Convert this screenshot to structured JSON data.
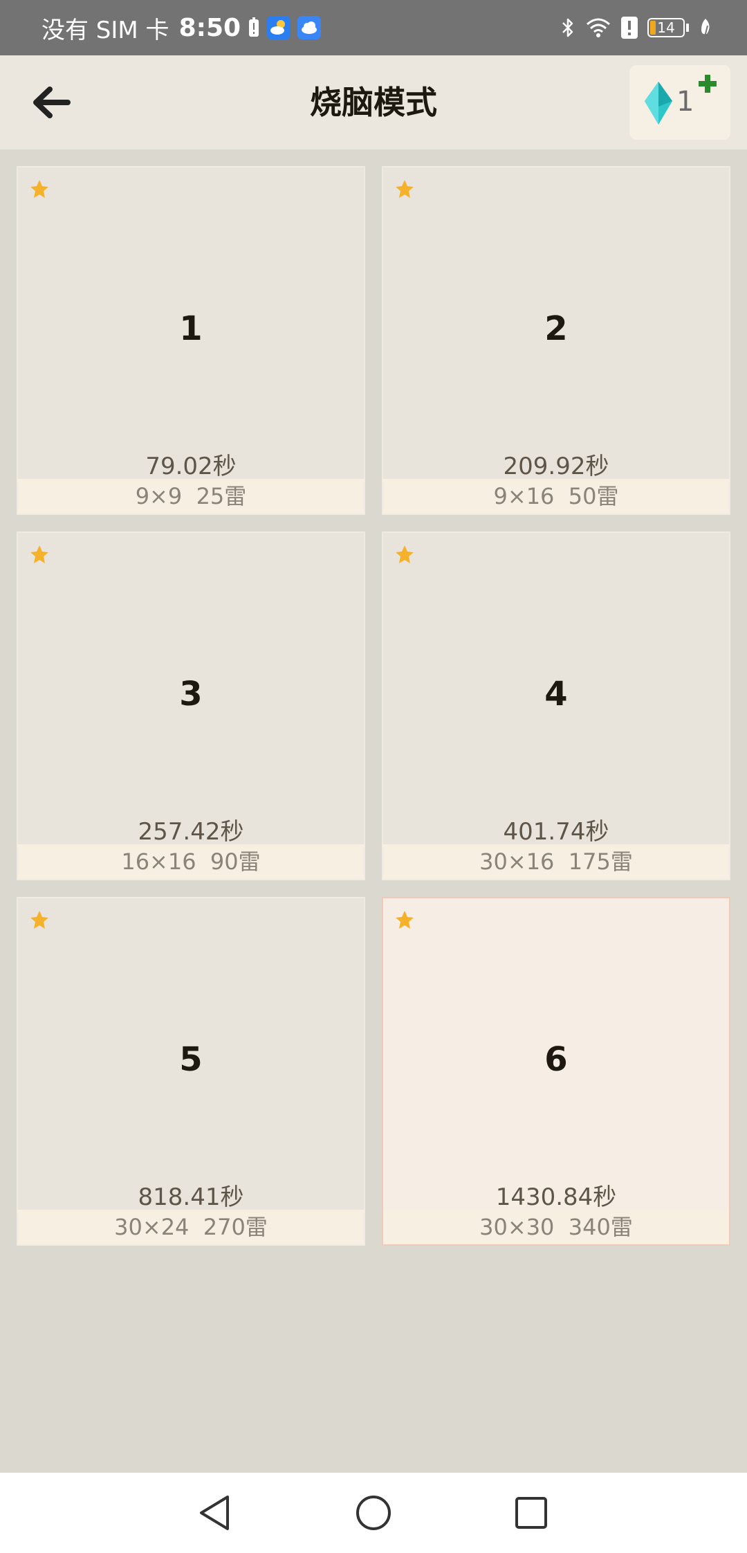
{
  "status_bar": {
    "carrier": "没有 SIM 卡",
    "time": "8:50",
    "battery_level": "14"
  },
  "header": {
    "title": "烧脑模式",
    "gem_count": "1"
  },
  "levels": [
    {
      "number": "1",
      "time": "79.02秒",
      "info": "9×9  25雷",
      "starred": true
    },
    {
      "number": "2",
      "time": "209.92秒",
      "info": "9×16  50雷",
      "starred": true
    },
    {
      "number": "3",
      "time": "257.42秒",
      "info": "16×16  90雷",
      "starred": true
    },
    {
      "number": "4",
      "time": "401.74秒",
      "info": "30×16  175雷",
      "starred": true
    },
    {
      "number": "5",
      "time": "818.41秒",
      "info": "30×24  270雷",
      "starred": true
    },
    {
      "number": "6",
      "time": "1430.84秒",
      "info": "30×30  340雷",
      "starred": true,
      "selected": true
    }
  ],
  "colors": {
    "star": "#f5b12a",
    "gem": "#2ec6c9",
    "plus": "#2a8a2c",
    "selected_border": "#f1c9ba"
  }
}
